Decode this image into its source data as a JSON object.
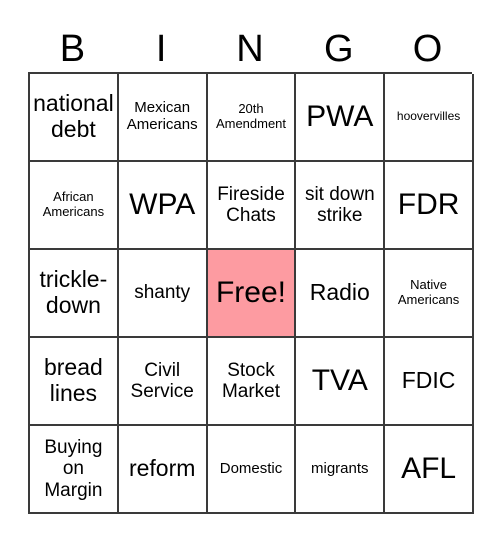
{
  "card": {
    "header_letters": [
      "B",
      "I",
      "N",
      "G",
      "O"
    ],
    "free_color": "#fd9ba1",
    "border_color": "#3a3a3a",
    "background_color": "#ffffff",
    "rows": [
      [
        {
          "text": "national debt",
          "size": "lg",
          "free": false
        },
        {
          "text": "Mexican Americans",
          "size": "sm",
          "free": false
        },
        {
          "text": "20th Amendment",
          "size": "xs",
          "free": false
        },
        {
          "text": "PWA",
          "size": "xl",
          "free": false
        },
        {
          "text": "hoovervilles",
          "size": "xxs",
          "free": false
        }
      ],
      [
        {
          "text": "African Americans",
          "size": "xs",
          "free": false
        },
        {
          "text": "WPA",
          "size": "xl",
          "free": false
        },
        {
          "text": "Fireside Chats",
          "size": "md",
          "free": false
        },
        {
          "text": "sit down strike",
          "size": "md",
          "free": false
        },
        {
          "text": "FDR",
          "size": "xl",
          "free": false
        }
      ],
      [
        {
          "text": "trickle-down",
          "size": "lg",
          "free": false
        },
        {
          "text": "shanty",
          "size": "md",
          "free": false
        },
        {
          "text": "Free!",
          "size": "xl",
          "free": true
        },
        {
          "text": "Radio",
          "size": "lg",
          "free": false
        },
        {
          "text": "Native Americans",
          "size": "xs",
          "free": false
        }
      ],
      [
        {
          "text": "bread lines",
          "size": "lg",
          "free": false
        },
        {
          "text": "Civil Service",
          "size": "md",
          "free": false
        },
        {
          "text": "Stock Market",
          "size": "md",
          "free": false
        },
        {
          "text": "TVA",
          "size": "xl",
          "free": false
        },
        {
          "text": "FDIC",
          "size": "lg",
          "free": false
        }
      ],
      [
        {
          "text": "Buying on Margin",
          "size": "md",
          "free": false
        },
        {
          "text": "reform",
          "size": "lg",
          "free": false
        },
        {
          "text": "Domestic",
          "size": "sm",
          "free": false
        },
        {
          "text": "migrants",
          "size": "sm",
          "free": false
        },
        {
          "text": "AFL",
          "size": "xl",
          "free": false
        }
      ]
    ]
  }
}
